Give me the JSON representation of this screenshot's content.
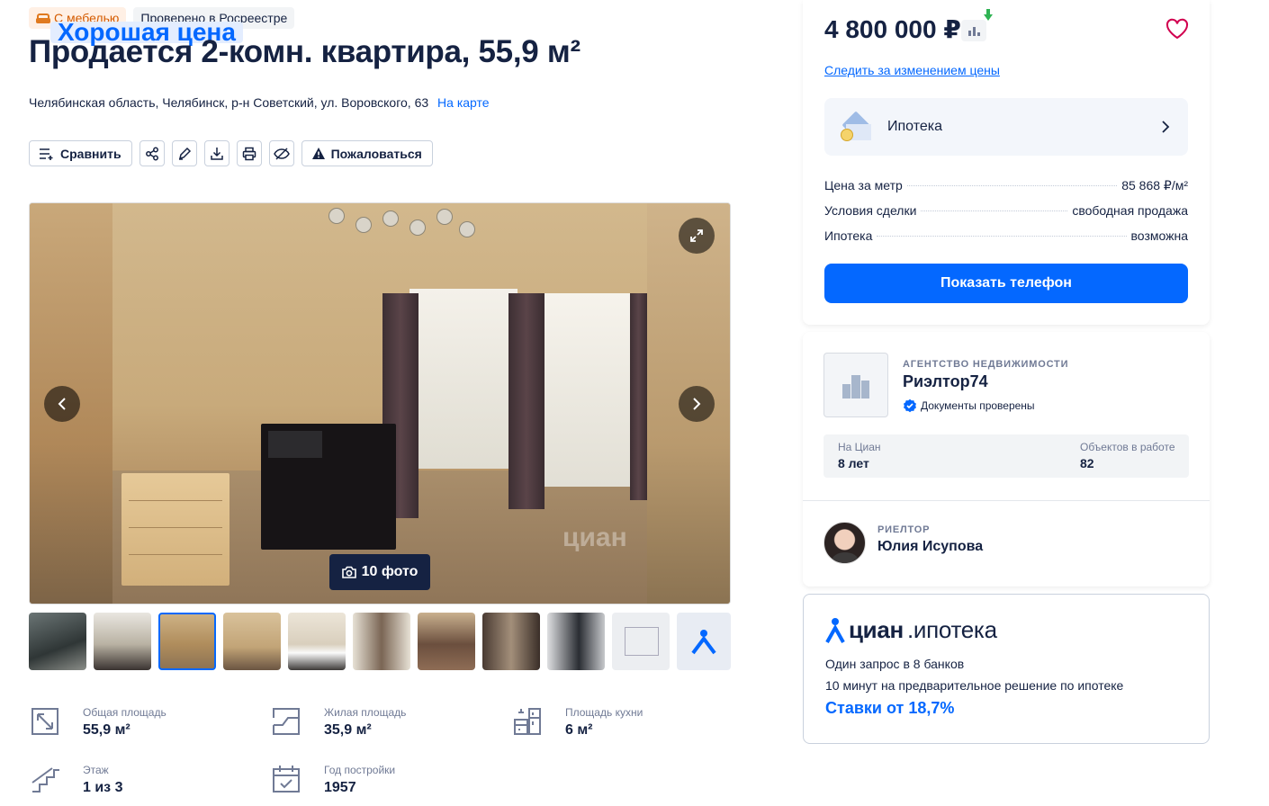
{
  "badges": {
    "good_price": "Хорошая цена",
    "furniture": "С мебелью",
    "rosreestr": "Проверено в Росреестре"
  },
  "title": "Продается 2-комн. квартира, 55,9 м²",
  "address": {
    "text": "Челябинская область, Челябинск, р-н Советский, ул. Воровского, 63",
    "map_link": "На карте"
  },
  "actions": {
    "compare": "Сравнить",
    "report": "Пожаловаться",
    "icons": [
      "share-icon",
      "edit-icon",
      "download-icon",
      "print-icon",
      "hide-icon"
    ]
  },
  "gallery": {
    "photo_count": "10 фото",
    "watermark": "циан",
    "thumbnail_count": 10,
    "active_thumbnail": 3
  },
  "params": [
    {
      "label": "Общая площадь",
      "value": "55,9 м²",
      "icon": "area-icon"
    },
    {
      "label": "Жилая площадь",
      "value": "35,9 м²",
      "icon": "living-area-icon"
    },
    {
      "label": "Площадь кухни",
      "value": "6 м²",
      "icon": "kitchen-icon"
    },
    {
      "label": "Этаж",
      "value": "1 из 3",
      "icon": "stairs-icon"
    },
    {
      "label": "Год постройки",
      "value": "1957",
      "icon": "calendar-icon"
    }
  ],
  "price_card": {
    "price": "4 800 000 ₽",
    "track_price": "Следить за изменением цены",
    "mortgage": "Ипотека",
    "details": [
      {
        "label": "Цена за метр",
        "value": "85 868 ₽/м²"
      },
      {
        "label": "Условия сделки",
        "value": "свободная продажа"
      },
      {
        "label": "Ипотека",
        "value": "возможна"
      }
    ],
    "show_phone": "Показать телефон"
  },
  "agent_card": {
    "agency_tag": "АГЕНТСТВО НЕДВИЖИМОСТИ",
    "agency_name": "Риэлтор74",
    "verified": "Документы проверены",
    "stats": [
      {
        "label": "На Циан",
        "value": "8 лет"
      },
      {
        "label": "Объектов в работе",
        "value": "82"
      }
    ],
    "realtor_tag": "РИЕЛТОР",
    "realtor_name": "Юлия Исупова"
  },
  "ipoteka_card": {
    "brand": "циан",
    "brand_sub": ".ипотека",
    "line1": "Один запрос в 8 банков",
    "line2": "10 минут на предварительное решение по ипотеке",
    "rate": "Ставки от 18,7%"
  },
  "colors": {
    "accent": "#0468ff",
    "text": "#152242",
    "muted": "#707a95",
    "good_price_bg": "#e3edff",
    "furniture_bg": "#fff0e5",
    "green_arrow": "#2fb353"
  }
}
